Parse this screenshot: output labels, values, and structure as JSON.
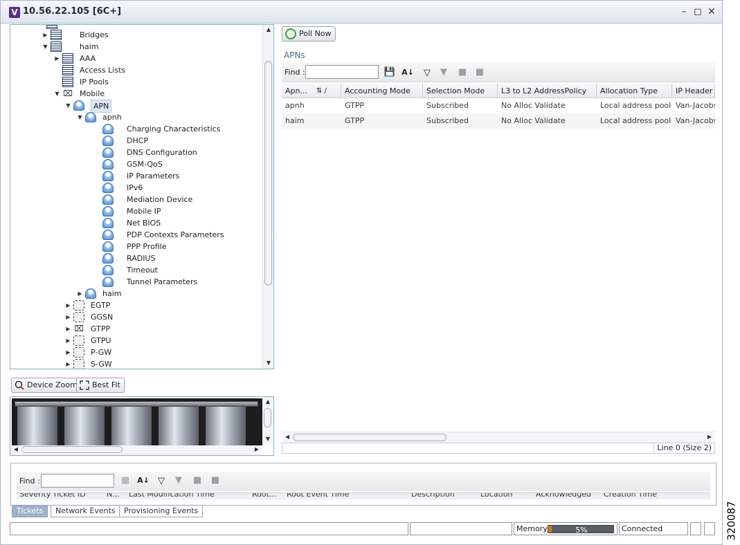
{
  "window": {
    "title": "10.56.22.105 [6C+]",
    "icon": "V"
  },
  "tree": {
    "items": [
      {
        "label": "Bridges",
        "depth": 1
      },
      {
        "label": "haim",
        "depth": 1
      },
      {
        "label": "AAA",
        "depth": 2
      },
      {
        "label": "Access Lists",
        "depth": 2
      },
      {
        "label": "IP Pools",
        "depth": 2
      },
      {
        "label": "Mobile",
        "depth": 2
      },
      {
        "label": "APN",
        "depth": 3
      },
      {
        "label": "apnh",
        "depth": 4
      },
      {
        "label": "Charging Characteristics",
        "depth": 5
      },
      {
        "label": "DHCP",
        "depth": 5
      },
      {
        "label": "DNS Configuration",
        "depth": 5
      },
      {
        "label": "GSM-QoS",
        "depth": 5
      },
      {
        "label": "IP Parameters",
        "depth": 5
      },
      {
        "label": "IPv6",
        "depth": 5
      },
      {
        "label": "Mediation Device",
        "depth": 5
      },
      {
        "label": "Mobile IP",
        "depth": 5
      },
      {
        "label": "Net BIOS",
        "depth": 5
      },
      {
        "label": "PDP Contexts Parameters",
        "depth": 5
      },
      {
        "label": "PPP Profile",
        "depth": 5
      },
      {
        "label": "RADIUS",
        "depth": 5
      },
      {
        "label": "Timeout",
        "depth": 5
      },
      {
        "label": "Tunnel Parameters",
        "depth": 5
      },
      {
        "label": "haim",
        "depth": 4
      },
      {
        "label": "EGTP",
        "depth": 3
      },
      {
        "label": "GGSN",
        "depth": 3
      },
      {
        "label": "GTPP",
        "depth": 3
      },
      {
        "label": "GTPU",
        "depth": 3
      },
      {
        "label": "P-GW",
        "depth": 3
      },
      {
        "label": "S-GW",
        "depth": 3
      }
    ]
  },
  "zoom": {
    "device_zoom": "Device Zoom",
    "best_fit": "Best Fit"
  },
  "right": {
    "poll_now": "Poll Now",
    "section_title": "APNs",
    "find_label": "Find :",
    "find_value": "",
    "columns": [
      "Apn...",
      "Accounting Mode",
      "Selection Mode",
      "L3 to L2 AddressPolicy",
      "Allocation Type",
      "IP Header C"
    ],
    "rows": [
      [
        "apnh",
        "GTPP",
        "Subscribed",
        "No Alloc Validate",
        "Local address pool",
        "Van-Jacobsc"
      ],
      [
        "haim",
        "GTPP",
        "Subscribed",
        "No Alloc Validate",
        "Local address pool",
        "Van-Jacobsc"
      ]
    ],
    "line_info": "Line 0 (Size 2)"
  },
  "bottom": {
    "find_label": "Find :",
    "find_value": "",
    "columns": [
      "Severity",
      "Ticket ID",
      "N...",
      "Last Modification Time",
      "Root...",
      "Root Event Time",
      "Description",
      "Location",
      "Acknowledged",
      "Creation Time"
    ],
    "tabs": [
      "Tickets",
      "Network Events",
      "Provisioning Events"
    ]
  },
  "status": {
    "memory_label": "Memory:",
    "memory_percent": "5%",
    "memory_fraction": 0.05,
    "connection": "Connected"
  },
  "figure_id": "320087",
  "colors": {
    "accent": "#9fb3c8",
    "selection": "#dce7f5",
    "memory_fill": "#d07a1e"
  }
}
